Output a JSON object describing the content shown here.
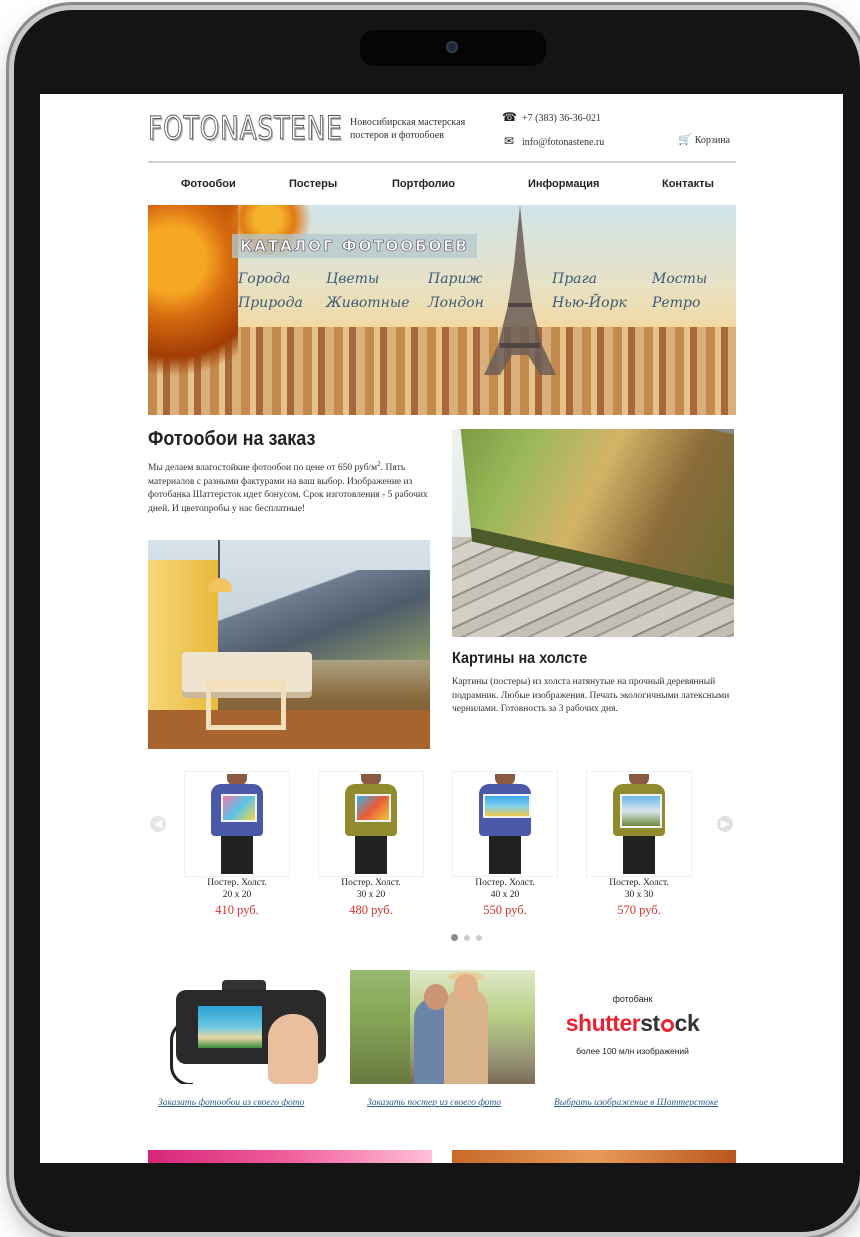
{
  "header": {
    "logo": "FOTONASTENE",
    "tagline_line1": "Новосибирская мастерская",
    "tagline_line2": "постеров и фотообоев",
    "phone": "+7 (383) 36-36-021",
    "email": "info@fotonastene.ru",
    "cart_label": "Корзина",
    "icons": {
      "phone": "phone-icon",
      "email": "envelope-icon",
      "cart": "cart-icon"
    }
  },
  "nav": {
    "items": [
      "Фотообои",
      "Постеры",
      "Портфолио",
      "Информация",
      "Контакты"
    ]
  },
  "banner": {
    "title": "КАТАЛОГ ФОТООБОЕВ",
    "categories": [
      "Города",
      "Природа",
      "Цветы",
      "Животные",
      "Париж",
      "Лондон",
      "Прага",
      "Нью-Йорк",
      "Мосты",
      "Ретро"
    ]
  },
  "wallpaper": {
    "title": "Фотообои на заказ",
    "text_before_sup": "Мы делаем влагостойкие фотообои по цене от 650 руб/м",
    "sup": "2",
    "text_after_sup": ". Пять материалов с разными фактурами на ваш выбор. Изображение из фотобанка Шаттерсток идет бонусом. Срок изготовления - 5 рабочих дней. И цветопробы у нас бесплатные!"
  },
  "canvas": {
    "title": "Картины на холсте",
    "text": "Картины (постеры) из холста натянутые на прочный деревянный подрамник. Любые изображения. Печать экологичными латексными чернилами. Готовность за 3 рабочих дня."
  },
  "products": [
    {
      "title": "Постер. Холст.",
      "size": "20 х 20",
      "price": "410 руб."
    },
    {
      "title": "Постер. Холст.",
      "size": "30 х 20",
      "price": "480 руб."
    },
    {
      "title": "Постер. Холст.",
      "size": "40 х 20",
      "price": "550 руб."
    },
    {
      "title": "Постер. Холст.",
      "size": "30 х 30",
      "price": "570 руб."
    }
  ],
  "carousel": {
    "prev_icon": "arrow-left-icon",
    "next_icon": "arrow-right-icon",
    "pages": 3,
    "active_page": 1
  },
  "promos": {
    "shutterstock": {
      "top": "фотобанк",
      "logo_part1": "shutter",
      "logo_part2": "st",
      "logo_part3": "ck",
      "sub": "более 100 млн изображений"
    },
    "links": [
      "Заказать фотообои из своего фото",
      "Заказать постер из своего фото",
      "Выбрать изображение в Шаттерстоке"
    ]
  },
  "colors": {
    "price": "#d0342c",
    "link": "#2e5e8e",
    "shutterstock_red": "#e62434"
  }
}
